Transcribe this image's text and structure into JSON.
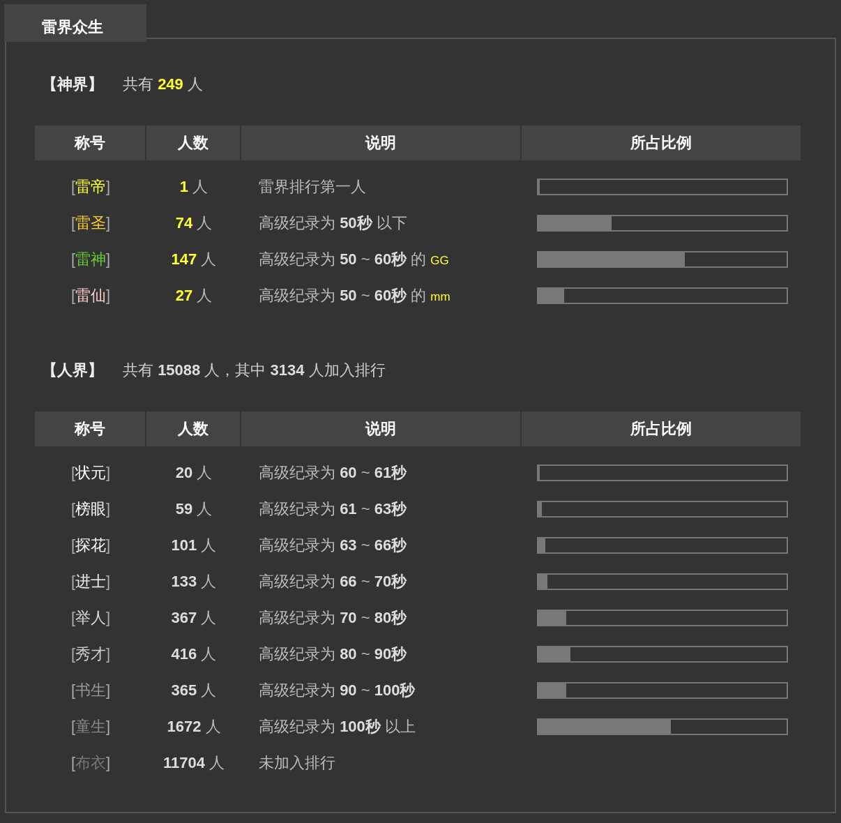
{
  "tab": {
    "label": "雷界众生",
    "selected": true
  },
  "sections": [
    {
      "kind": "god",
      "label": "【神界】",
      "summary": "共有 **249** 人",
      "columns": [
        "称号",
        "人数",
        "说明",
        "所占比例"
      ],
      "rows": [
        {
          "open": "[",
          "close": "]",
          "title": "雷帝",
          "color": "#ffff33",
          "count": "1",
          "unit": "人",
          "desc": "雷界排行第一人",
          "level": 0.004
        },
        {
          "open": "[",
          "close": "]",
          "title": "雷圣",
          "color": "#ffcc33",
          "count": "74",
          "unit": "人",
          "desc": "高级纪录为 **50秒** 以下",
          "level": 0.297
        },
        {
          "open": "[",
          "close": "]",
          "title": "雷神",
          "color": "#66cc33",
          "count": "147",
          "unit": "人",
          "desc": "高级纪录为 **50** ~ **60秒** 的",
          "suffix": "GG",
          "level": 0.59
        },
        {
          "open": "[",
          "close": "]",
          "title": "雷仙",
          "color": "#ffcccc",
          "count": "27",
          "unit": "人",
          "desc": "高级纪录为 **50** ~ **60秒** 的",
          "suffix": "mm",
          "level": 0.108
        }
      ]
    },
    {
      "kind": "human",
      "label": "【人界】",
      "summary": "共有 **15088** 人，其中 **3134** 人加入排行",
      "columns": [
        "称号",
        "人数",
        "说明",
        "所占比例"
      ],
      "rows": [
        {
          "open": "[",
          "close": "]",
          "title": "状元",
          "color": "#ffffff",
          "count": "20",
          "unit": "人",
          "desc": "高级纪录为 **60** ~ **61秒**",
          "level": 0.006
        },
        {
          "open": "[",
          "close": "]",
          "title": "榜眼",
          "color": "#ffffff",
          "count": "59",
          "unit": "人",
          "desc": "高级纪录为 **61** ~ **63秒**",
          "level": 0.019
        },
        {
          "open": "[",
          "close": "]",
          "title": "探花",
          "color": "#ffffff",
          "count": "101",
          "unit": "人",
          "desc": "高级纪录为 **63** ~ **66秒**",
          "level": 0.032
        },
        {
          "open": "[",
          "close": "]",
          "title": "进士",
          "color": "#eeeeee",
          "count": "133",
          "unit": "人",
          "desc": "高级纪录为 **66** ~ **70秒**",
          "level": 0.042
        },
        {
          "open": "[",
          "close": "]",
          "title": "举人",
          "color": "#dddddd",
          "count": "367",
          "unit": "人",
          "desc": "高级纪录为 **70** ~ **80秒**",
          "level": 0.117
        },
        {
          "open": "[",
          "close": "]",
          "title": "秀才",
          "color": "#cccccc",
          "count": "416",
          "unit": "人",
          "desc": "高级纪录为 **80** ~ **90秒**",
          "level": 0.133
        },
        {
          "open": "[",
          "close": "]",
          "title": "书生",
          "color": "#999999",
          "count": "365",
          "unit": "人",
          "desc": "高级纪录为 **90** ~ **100秒**",
          "level": 0.116
        },
        {
          "open": "[",
          "close": "]",
          "title": "童生",
          "color": "#888888",
          "count": "1672",
          "unit": "人",
          "desc": "高级纪录为 **100秒** 以上",
          "level": 0.533
        },
        {
          "open": "[",
          "close": "]",
          "title": "布衣",
          "color": "#777777",
          "count": "11704",
          "unit": "人",
          "desc": "未加入排行"
        }
      ]
    }
  ]
}
